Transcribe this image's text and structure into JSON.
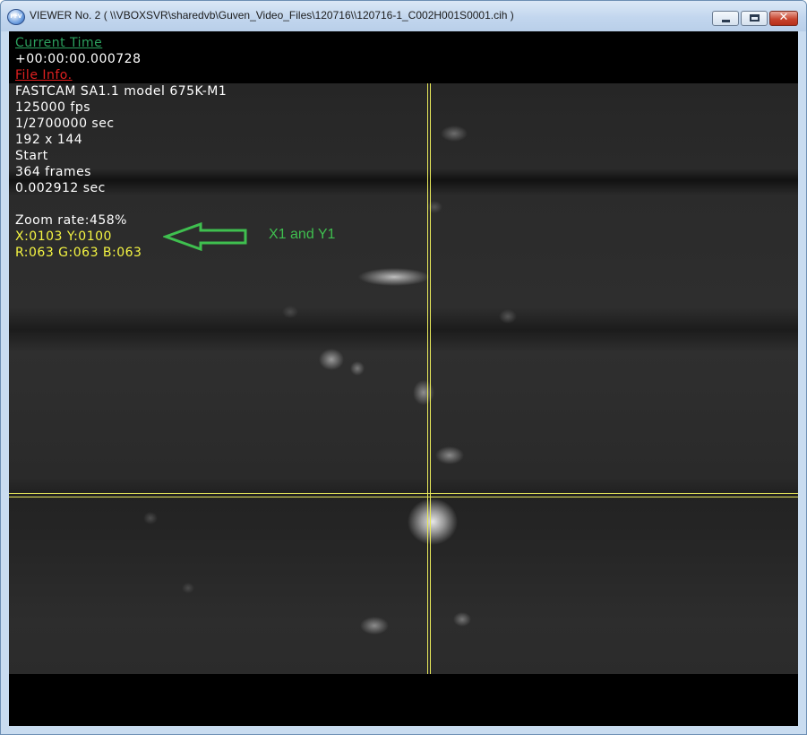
{
  "window": {
    "title": "VIEWER No. 2 ( \\\\VBOXSVR\\sharedvb\\Guven_Video_Files\\120716\\\\120716-1_C002H001S0001.cih )",
    "app_icon_label": "PFV",
    "minimize_icon": "minimize-icon",
    "maximize_icon": "maximize-icon",
    "close_icon": "close-icon"
  },
  "overlay": {
    "current_time_label": "Current Time",
    "current_time_value": "+00:00:00.000728",
    "file_info_label": "File Info.",
    "camera_model": "FASTCAM SA1.1 model 675K-M1",
    "frame_rate": "125000 fps",
    "shutter": "1/2700000 sec",
    "resolution": "192 x 144",
    "trigger_mode": "Start",
    "total_frames": "364 frames",
    "duration": "0.002912 sec",
    "zoom_rate": "Zoom rate:458%",
    "cursor_xy": "X:0103 Y:0100",
    "cursor_rgb": "R:063 G:063 B:063"
  },
  "annotation": {
    "text": "X1 and Y1",
    "color": "#3fbf4f"
  },
  "colors": {
    "label_green": "#2ca25f",
    "label_red": "#e02020",
    "cursor_yellow": "#f5f542",
    "crosshair": "#e8e85a"
  }
}
